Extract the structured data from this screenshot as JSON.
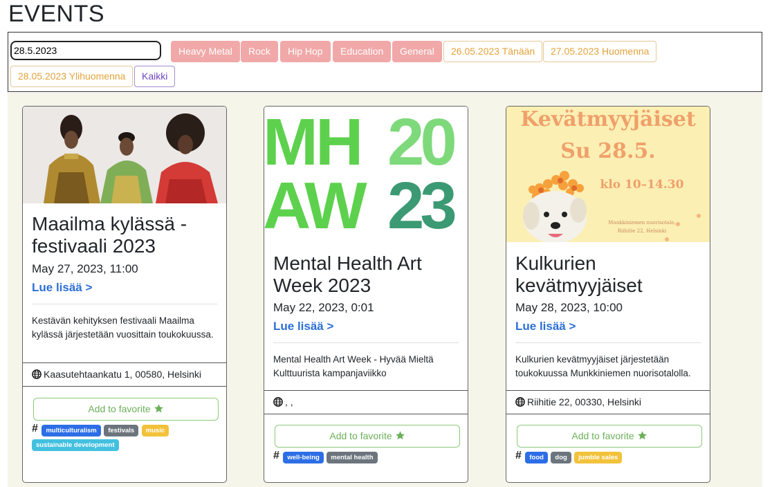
{
  "page": {
    "title": "EVENTS"
  },
  "filters": {
    "date_value": "28.5.2023",
    "categories": [
      "Heavy Metal",
      "Rock",
      "Hip Hop",
      "Education",
      "General"
    ],
    "dates": [
      "26.05.2023 Tänään",
      "27.05.2023 Huomenna",
      "28.05.2023 Ylihuomenna"
    ],
    "all_label": "Kaikki"
  },
  "events": [
    {
      "title": "Maailma kylässä -festivaali 2023",
      "date": "May 27, 2023, 11:00",
      "link": "Lue lisää >",
      "description": "Kestävän kehityksen festivaali Maailma kylässä järjestetään vuosittain toukokuussa.",
      "location": "Kaasutehtaankatu 1, 00580, Helsinki",
      "favorite_label": "Add to favorite",
      "hash": "#",
      "tags": [
        "multiculturalism",
        "festivals",
        "music",
        "sustainable development"
      ],
      "tag_colors": [
        "blue",
        "grey",
        "yellow",
        "cyan"
      ]
    },
    {
      "title": "Mental Health Art Week 2023",
      "date": "May 22, 2023, 0:01",
      "link": "Lue lisää >",
      "description": "Mental Health Art Week - Hyvää Mieltä Kulttuurista kampanjaviikko",
      "location": ", ,",
      "favorite_label": "Add to favorite",
      "hash": "#",
      "tags": [
        "well-being",
        "mental health"
      ],
      "tag_colors": [
        "blue",
        "grey"
      ],
      "image_text": {
        "line1": "MH",
        "line2": "AW",
        "year1": "20",
        "year2": "23"
      }
    },
    {
      "title": "Kulkurien kevätmyyjäiset",
      "date": "May 28, 2023, 10:00",
      "link": "Lue lisää >",
      "description": "Kulkurien kevätmyyjäiset järjestetään toukokuussa Munkkiniemen nuorisotalolla.",
      "location": "Riihitie 22, 00330, Helsinki",
      "favorite_label": "Add to favorite",
      "hash": "#",
      "tags": [
        "food",
        "dog",
        "jumble sales"
      ],
      "tag_colors": [
        "blue",
        "grey",
        "yellow"
      ],
      "image_text": {
        "headline": "Kevätmyyjäiset",
        "day": "Su 28.5.",
        "time": "klo 10–14.30",
        "venue": "Munkkiniemen nuorisotalo,",
        "address": "Riihitie 22, Helsinki"
      }
    }
  ],
  "colors": {
    "category_button": "#f1a8a8",
    "date_button_text": "#e2a23a",
    "all_button_text": "#6f42c1",
    "link": "#2b6fd6",
    "favorite": "#6cb05a",
    "area_background": "#f5f5ea"
  },
  "icons": [
    "globe-icon",
    "star-icon"
  ]
}
